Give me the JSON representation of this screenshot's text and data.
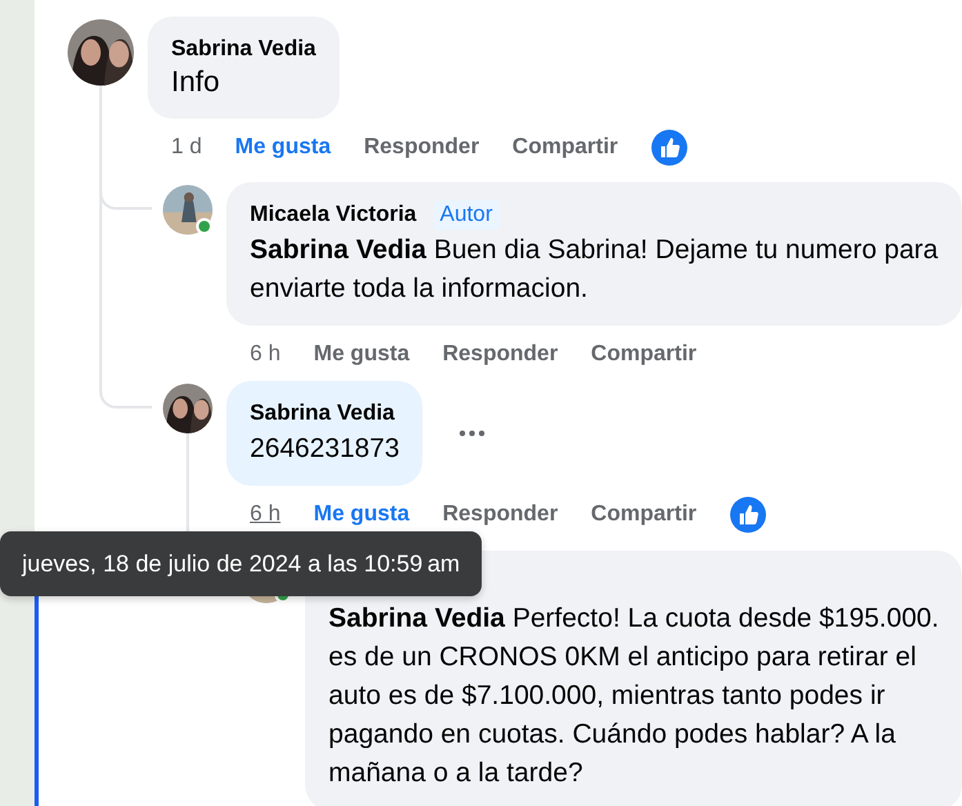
{
  "comments": [
    {
      "author": "Sabrina Vedia",
      "text": "Info",
      "time": "1 d",
      "time_underlined": false,
      "actions": [
        "Me gusta",
        "Responder",
        "Compartir"
      ],
      "liked": true,
      "like_reaction": true,
      "replies": [
        {
          "author": "Micaela Victoria",
          "badge": "Autor",
          "text": "**Sabrina Vedia** Buen dia Sabrina! Dejame tu numero para enviarte toda la informacion.",
          "time": "6 h",
          "time_underlined": false,
          "actions": [
            "Me gusta",
            "Responder",
            "Compartir"
          ],
          "liked": false,
          "online": true
        },
        {
          "author": "Sabrina Vedia",
          "text": "2646231873",
          "time": "6 h",
          "time_underlined": true,
          "actions": [
            "Me gusta",
            "Responder",
            "Compartir"
          ],
          "liked": true,
          "like_reaction": true,
          "highlighted": true,
          "more_button": true,
          "replies": [
            {
              "text": "**Sabrina Vedia** Perfecto! La cuota desde $195.000. es de un CRONOS 0KM el anticipo para retirar el auto es de $7.100.000, mientras tanto podes ir pagando en cuotas. Cuándo podes hablar? A la mañana o a la tarde?",
              "online": true
            }
          ]
        }
      ]
    }
  ],
  "tooltip": "jueves, 18 de julio de 2024 a las 10:59 am"
}
